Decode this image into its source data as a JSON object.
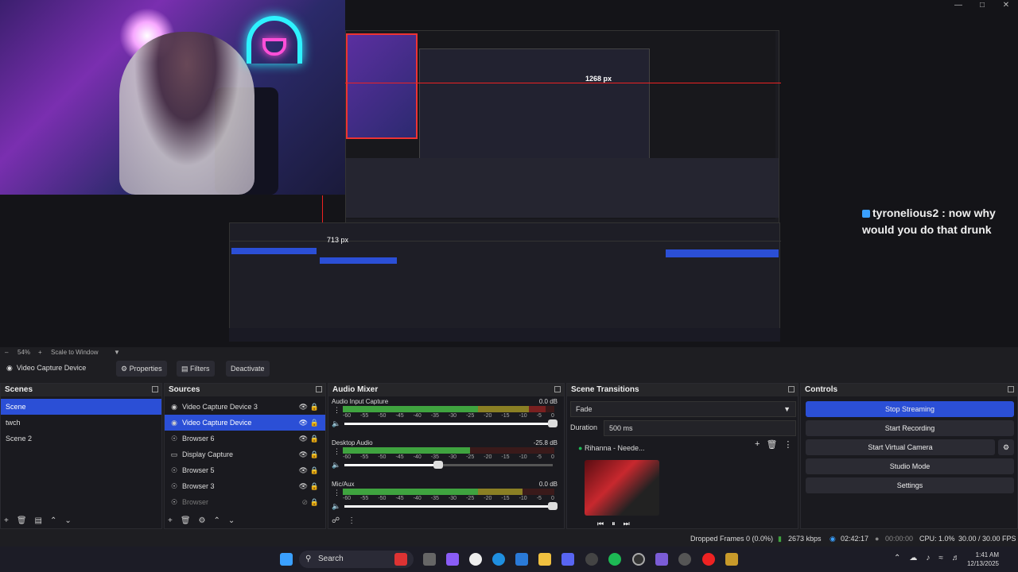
{
  "chat": {
    "user": "tyronelious2",
    "message": ": now why would you do that drunk"
  },
  "preview": {
    "width_label": "1268 px",
    "height_label": "713 px",
    "zoom": "54%",
    "scale_mode": "Scale to Window"
  },
  "source_toolbar": {
    "source_name": "Video Capture Device",
    "properties": "Properties",
    "filters": "Filters",
    "deactivate": "Deactivate"
  },
  "scenes": {
    "title": "Scenes",
    "items": [
      "Scene",
      "twch",
      "Scene 2"
    ],
    "selected": "Scene"
  },
  "sources": {
    "title": "Sources",
    "items": [
      {
        "label": "Video Capture Device 3",
        "icon": "camera-icon"
      },
      {
        "label": "Video Capture Device",
        "icon": "camera-icon"
      },
      {
        "label": "Browser 6",
        "icon": "globe-icon"
      },
      {
        "label": "Display Capture",
        "icon": "monitor-icon"
      },
      {
        "label": "Browser 5",
        "icon": "globe-icon"
      },
      {
        "label": "Browser 3",
        "icon": "globe-icon"
      },
      {
        "label": "Browser",
        "icon": "globe-icon"
      }
    ],
    "selected": "Video Capture Device"
  },
  "audio_mixer": {
    "title": "Audio Mixer",
    "ticks": [
      "-60",
      "-55",
      "-50",
      "-45",
      "-40",
      "-35",
      "-30",
      "-25",
      "-20",
      "-15",
      "-10",
      "-5",
      "0"
    ],
    "channels": [
      {
        "name": "Audio Input Capture",
        "db": "0.0 dB",
        "level": 0.96,
        "volume": 1.0
      },
      {
        "name": "Desktop Audio",
        "db": "-25.8 dB",
        "level": 0.6,
        "volume": 0.45
      },
      {
        "name": "Mic/Aux",
        "db": "0.0 dB",
        "level": 0.85,
        "volume": 1.0
      }
    ]
  },
  "scene_transitions": {
    "title": "Scene Transitions",
    "transition": "Fade",
    "duration_label": "Duration",
    "duration_value": "500 ms",
    "now_playing": "Rihanna - Neede..."
  },
  "controls": {
    "title": "Controls",
    "buttons": [
      "Stop Streaming",
      "Start Recording",
      "Start Virtual Camera",
      "Studio Mode",
      "Settings"
    ]
  },
  "status": {
    "dropped_frames": "Dropped Frames 0 (0.0%)",
    "bitrate": "2673 kbps",
    "stream_time": "02:42:17",
    "rec_time": "00:00:00",
    "cpu": "CPU: 1.0%",
    "fps": "30.00 / 30.00 FPS"
  },
  "taskbar": {
    "search_label": "Search",
    "time": "1:41 AM",
    "date": "12/13/2025"
  },
  "colors": {
    "accent": "#2b4fd6",
    "meter_green": "#3fa33f",
    "meter_yellow": "#8a7f24",
    "meter_red": "#7a2020"
  }
}
